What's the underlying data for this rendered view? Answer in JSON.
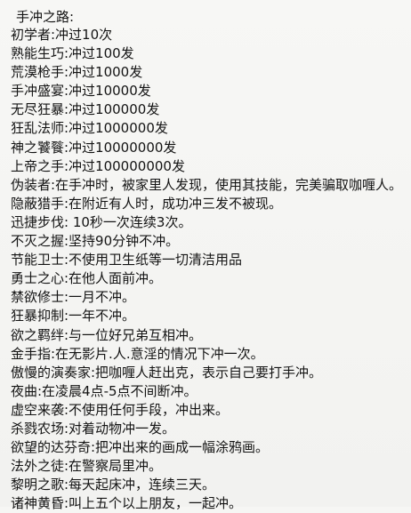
{
  "document": {
    "title": "手冲之路:",
    "lines": [
      "初学者:冲过10次",
      "熟能生巧:冲过100发",
      "荒漠枪手:冲过1000发",
      "手冲盛宴:冲过10000发",
      "无尽狂暴:冲过100000发",
      "狂乱法师:冲过1000000发",
      "神之饕餮:冲过10000000发",
      "上帝之手:冲过100000000发",
      "伪装者:在手冲时，被家里人发现，使用其技能，完美骗取咖喱人。",
      "隐蔽猎手:在附近有人时，成功冲三发不被现。",
      "迅捷步伐: 10秒一次连续3次。",
      "不灭之握:坚持90分钟不冲。",
      "节能卫士:不使用卫生纸等一切清洁用品",
      "勇士之心:在他人面前冲。",
      "禁欲修士:一月不冲。",
      "狂暴抑制:一年不冲。",
      "欲之羁绊:与一位好兄弟互相冲。",
      "金手指:在无影片.人.意淫的情况下冲一次。",
      "傲慢的演奏家:把咖喱人赶出克，表示自己要打手冲。",
      "夜曲:在凌晨4点-5点不间断冲。",
      "虚空来袭:不使用任何手段，冲出来。",
      "杀戮农场:对着动物冲一发。",
      "欲望的达芬奇:把冲出来的画成一幅涂鸦画。",
      "法外之徒:在警察局里冲。",
      "黎明之歌:每天起床冲，连续三天。",
      "诸神黄昏:叫上五个以上朋友，一起冲。"
    ]
  }
}
